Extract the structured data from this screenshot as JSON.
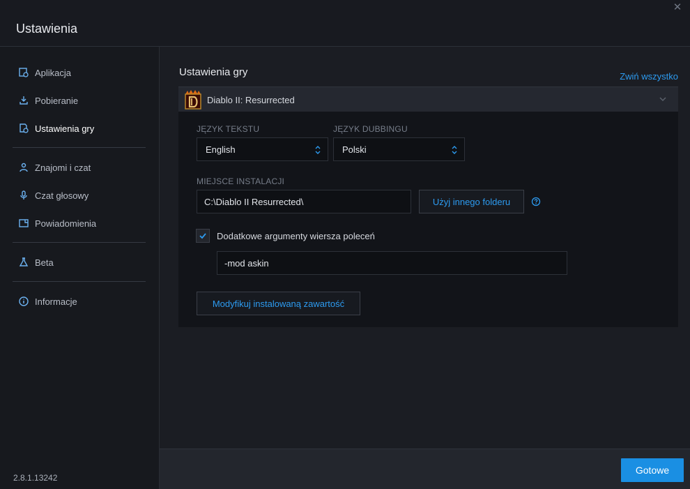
{
  "window": {
    "title": "Ustawienia"
  },
  "sidebar": {
    "items": [
      {
        "label": "Aplikacja",
        "icon": "app-settings-icon"
      },
      {
        "label": "Pobieranie",
        "icon": "download-icon"
      },
      {
        "label": "Ustawienia gry",
        "icon": "game-settings-icon",
        "active": true
      },
      {
        "label": "Znajomi i czat",
        "icon": "friends-icon"
      },
      {
        "label": "Czat głosowy",
        "icon": "microphone-icon"
      },
      {
        "label": "Powiadomienia",
        "icon": "notifications-icon"
      },
      {
        "label": "Beta",
        "icon": "flask-icon"
      },
      {
        "label": "Informacje",
        "icon": "info-icon"
      }
    ],
    "version": "2.8.1.13242"
  },
  "main": {
    "title": "Ustawienia gry",
    "collapse_all": "Zwiń wszystko",
    "game": {
      "name": "Diablo II: Resurrected",
      "text_language_label": "JĘZYK TEKSTU",
      "text_language_value": "English",
      "dub_language_label": "JĘZYK DUBBINGU",
      "dub_language_value": "Polski",
      "install_label": "MIEJSCE INSTALACJI",
      "install_path": "C:\\Diablo II Resurrected\\",
      "other_folder_button": "Użyj innego folderu",
      "extra_args_label": "Dodatkowe argumenty wiersza poleceń",
      "extra_args_checked": true,
      "extra_args_value": "-mod askin",
      "modify_button": "Modyfikuj instalowaną zawartość"
    }
  },
  "footer": {
    "done_button": "Gotowe"
  },
  "colors": {
    "accent": "#2d9bf0",
    "primary_button": "#1a8fe3",
    "background": "#16181d"
  }
}
